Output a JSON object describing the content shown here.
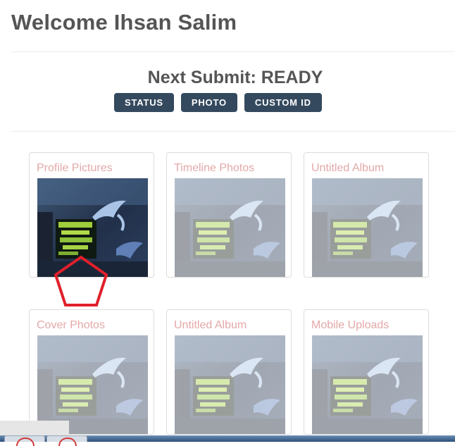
{
  "header": {
    "welcome": "Welcome Ihsan Salim"
  },
  "submit": {
    "label": "Next Submit: READY",
    "buttons": [
      "STATUS",
      "PHOTO",
      "CUSTOM ID"
    ]
  },
  "albums": [
    {
      "title": "Profile Pictures",
      "faded": false
    },
    {
      "title": "Timeline Photos",
      "faded": true
    },
    {
      "title": "Untitled Album",
      "faded": true
    },
    {
      "title": "Cover Photos",
      "faded": true
    },
    {
      "title": "Untitled Album",
      "faded": true
    },
    {
      "title": "Mobile Uploads",
      "faded": true
    }
  ],
  "colors": {
    "button_bg": "#34495e",
    "album_title": "#e4a8a8",
    "annotation": "#e0202a"
  },
  "icons": {
    "annotation_shape": "pentagon-outline",
    "taskbar_app": "browser-icon"
  }
}
